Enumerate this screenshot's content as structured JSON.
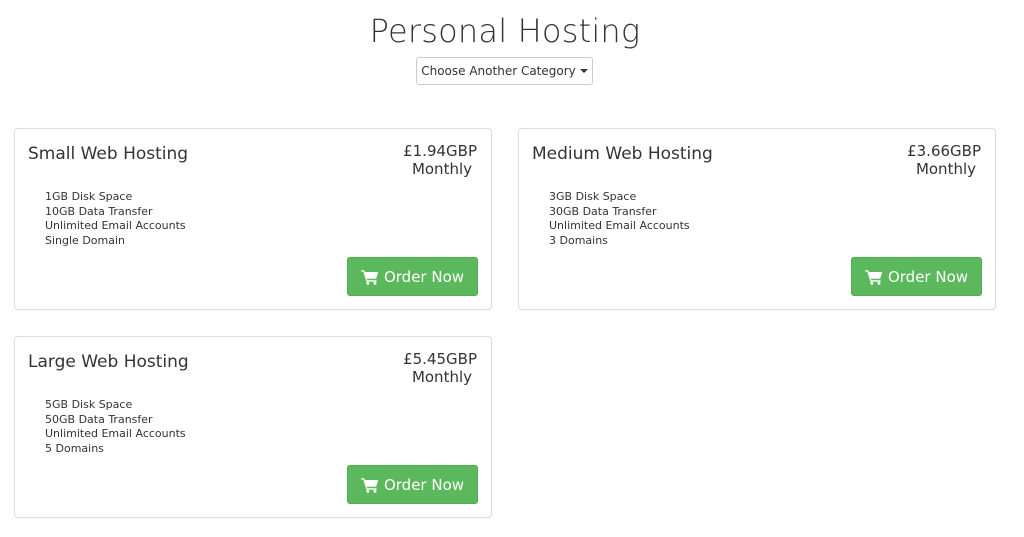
{
  "page": {
    "title": "Personal Hosting",
    "category_button": "Choose Another Category"
  },
  "plans": [
    {
      "name": "Small Web Hosting",
      "price": "£1.94GBP",
      "period": "Monthly",
      "features": [
        "1GB Disk Space",
        "10GB Data Transfer",
        "Unlimited Email Accounts",
        "Single Domain"
      ],
      "button": "Order Now"
    },
    {
      "name": "Medium Web Hosting",
      "price": "£3.66GBP",
      "period": "Monthly",
      "features": [
        "3GB Disk Space",
        "30GB Data Transfer",
        "Unlimited Email Accounts",
        "3 Domains"
      ],
      "button": "Order Now"
    },
    {
      "name": "Large Web Hosting",
      "price": "£5.45GBP",
      "period": "Monthly",
      "features": [
        "5GB Disk Space",
        "50GB Data Transfer",
        "Unlimited Email Accounts",
        "5 Domains"
      ],
      "button": "Order Now"
    }
  ],
  "icons": {
    "cart": "shopping-cart-icon",
    "dropdown": "caret-down-icon"
  },
  "colors": {
    "accent": "#5cb85c",
    "text": "#333333",
    "border": "#dcdcdc"
  }
}
